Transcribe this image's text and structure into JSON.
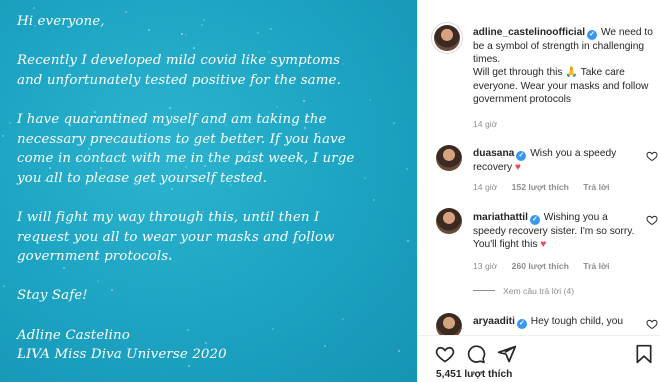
{
  "letter": {
    "lines": [
      "Hi everyone,",
      "",
      "Recently I developed mild covid like symptoms",
      "and unfortunately tested positive for the same.",
      "",
      "I have quarantined myself and am taking the",
      "necessary precautions to get better. If you have",
      "come in contact with me in the past week, I urge",
      "you all to please get yourself tested.",
      "",
      "I will fight my way through this, until then I",
      "request you all to wear your masks and follow",
      "government protocols.",
      "",
      "Stay Safe!",
      "",
      "Adline Castelino",
      "LIVA Miss Diva Universe 2020"
    ]
  },
  "caption": {
    "username": "adline_castelinoofficial",
    "text_part1": "We need to be a symbol of strength in challenging times.",
    "text_part2": "Will get through this",
    "emoji": "🙏",
    "text_part3": "Take care everyone. Wear your masks and follow government protocols",
    "time": "14 giờ"
  },
  "comments": [
    {
      "username": "duasana",
      "text": "Wish you a speedy recovery",
      "emoji": "♥",
      "time": "14 giờ",
      "likes": "152 lượt thích",
      "reply": "Trả lời"
    },
    {
      "username": "mariathattil",
      "text": "Wishing you a speedy recovery sister. I'm so sorry. You'll fight this",
      "emoji": "♥",
      "time": "13 giờ",
      "likes": "260 lượt thích",
      "reply": "Trả lời",
      "view_replies": "Xem câu trả lời (4)"
    },
    {
      "username": "aryaaditi",
      "text": "Hey tough child, you"
    }
  ],
  "footer": {
    "likes": "5,451 lượt thích",
    "icons": [
      "heart-icon",
      "comment-icon",
      "share-icon",
      "bookmark-icon"
    ]
  },
  "colors": {
    "image_bg": "#1ea6c4",
    "verified": "#3897f0",
    "heart": "#ed4956",
    "meta": "#8e8e8e"
  }
}
